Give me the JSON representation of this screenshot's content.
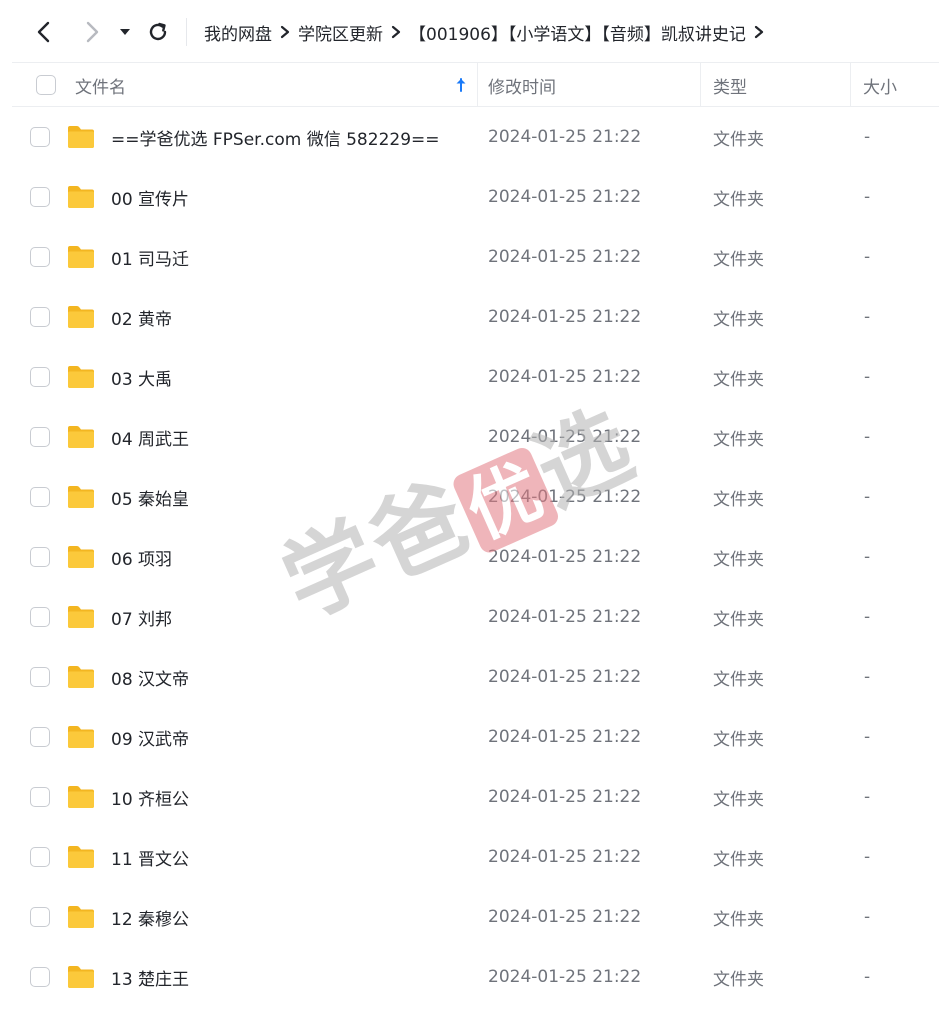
{
  "toolbar": {
    "breadcrumb": [
      "我的网盘",
      "学院区更新",
      "【001906】【小学语文】【音频】凯叔讲史记"
    ]
  },
  "header": {
    "name": "文件名",
    "mtime": "修改时间",
    "type": "类型",
    "size": "大小"
  },
  "rows": [
    {
      "name": "==学爸优选 FPSer.com 微信 582229==",
      "mtime": "2024-01-25 21:22",
      "type": "文件夹",
      "size": "-"
    },
    {
      "name": "00 宣传片",
      "mtime": "2024-01-25 21:22",
      "type": "文件夹",
      "size": "-"
    },
    {
      "name": "01 司马迁",
      "mtime": "2024-01-25 21:22",
      "type": "文件夹",
      "size": "-"
    },
    {
      "name": "02 黄帝",
      "mtime": "2024-01-25 21:22",
      "type": "文件夹",
      "size": "-"
    },
    {
      "name": "03 大禹",
      "mtime": "2024-01-25 21:22",
      "type": "文件夹",
      "size": "-"
    },
    {
      "name": "04 周武王",
      "mtime": "2024-01-25 21:22",
      "type": "文件夹",
      "size": "-"
    },
    {
      "name": "05 秦始皇",
      "mtime": "2024-01-25 21:22",
      "type": "文件夹",
      "size": "-"
    },
    {
      "name": "06 项羽",
      "mtime": "2024-01-25 21:22",
      "type": "文件夹",
      "size": "-"
    },
    {
      "name": "07 刘邦",
      "mtime": "2024-01-25 21:22",
      "type": "文件夹",
      "size": "-"
    },
    {
      "name": "08 汉文帝",
      "mtime": "2024-01-25 21:22",
      "type": "文件夹",
      "size": "-"
    },
    {
      "name": "09 汉武帝",
      "mtime": "2024-01-25 21:22",
      "type": "文件夹",
      "size": "-"
    },
    {
      "name": "10 齐桓公",
      "mtime": "2024-01-25 21:22",
      "type": "文件夹",
      "size": "-"
    },
    {
      "name": "11 晋文公",
      "mtime": "2024-01-25 21:22",
      "type": "文件夹",
      "size": "-"
    },
    {
      "name": "12 秦穆公",
      "mtime": "2024-01-25 21:22",
      "type": "文件夹",
      "size": "-"
    },
    {
      "name": "13 楚庄王",
      "mtime": "2024-01-25 21:22",
      "type": "文件夹",
      "size": "-"
    }
  ],
  "watermark": {
    "text": "学爸",
    "seal": "优",
    "tail": "选"
  },
  "colors": {
    "folder": "#fbc93b",
    "folder_dark": "#f3b621",
    "sort_arrow": "#1a7af8",
    "watermark_seal": "#e27a82"
  },
  "icons": [
    "back-arrow-icon",
    "forward-arrow-icon",
    "dropdown-caret-icon",
    "refresh-icon",
    "chevron-right-icon",
    "sort-up-arrow-icon",
    "folder-icon"
  ]
}
